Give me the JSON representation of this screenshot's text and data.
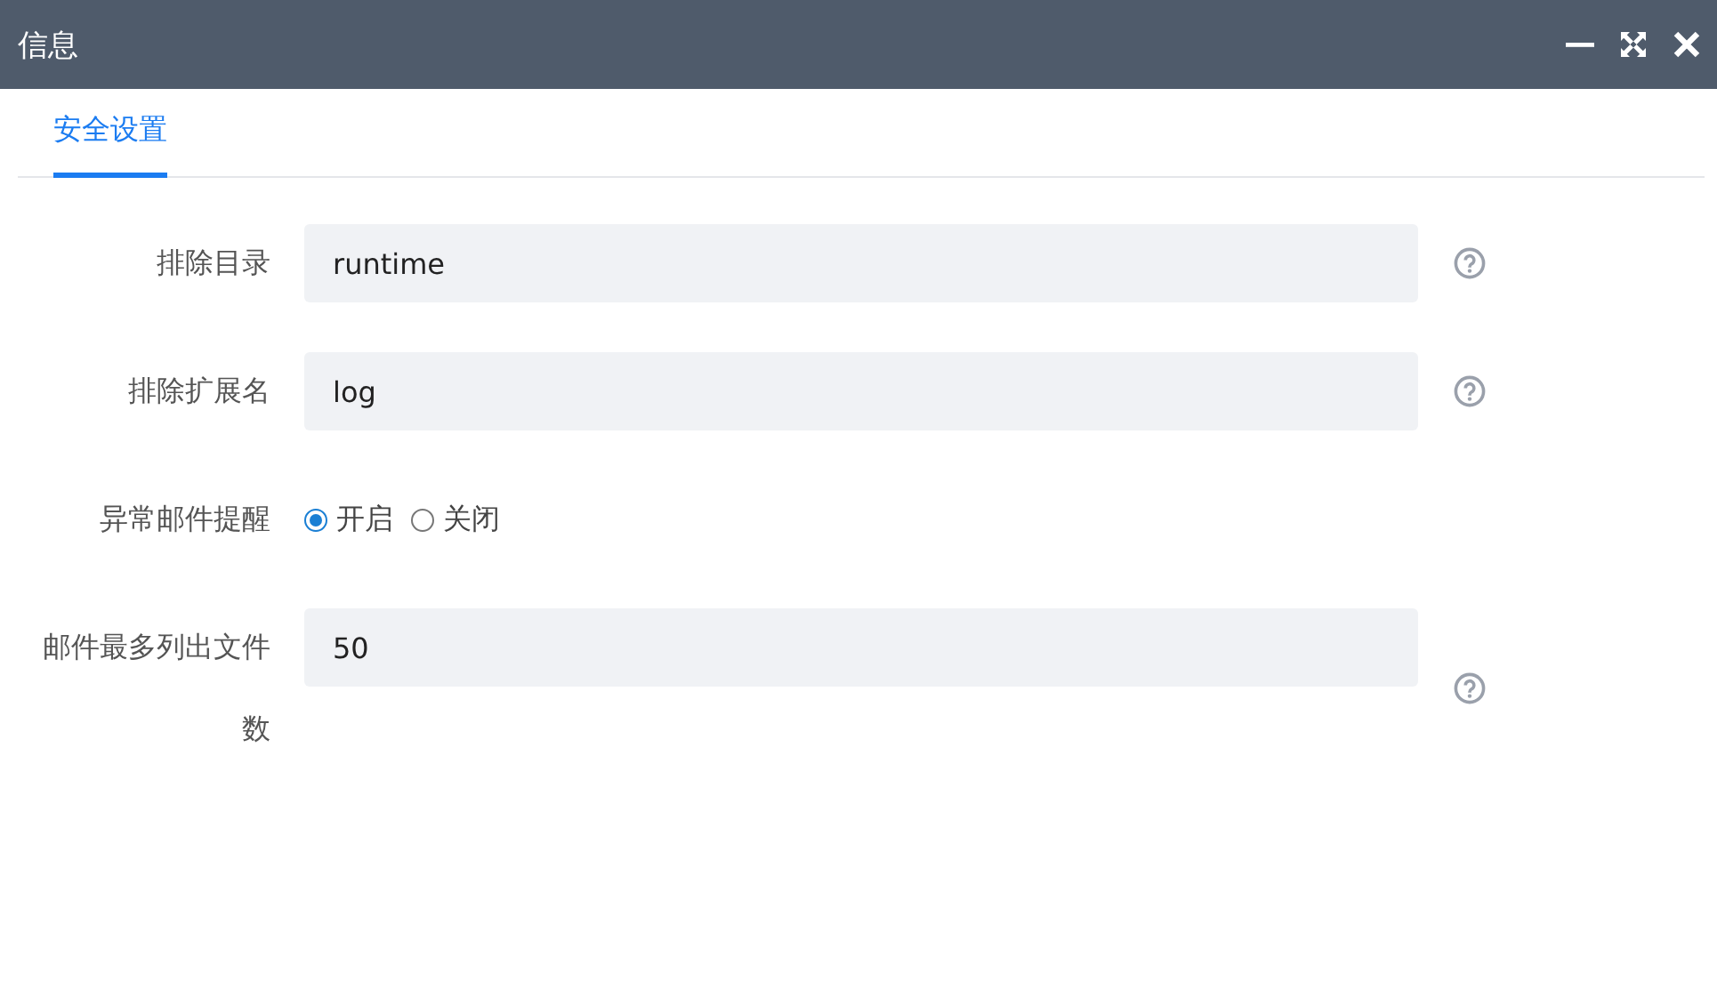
{
  "window": {
    "title": "信息"
  },
  "tabs": [
    {
      "label": "安全设置",
      "selected": true
    }
  ],
  "form": [
    {
      "kind": "text",
      "label": "排除目录",
      "value": "runtime",
      "help": true
    },
    {
      "kind": "text",
      "label": "排除扩展名",
      "value": "log",
      "help": true
    },
    {
      "kind": "radio",
      "label": "异常邮件提醒",
      "options": [
        {
          "label": "开启",
          "selected": true
        },
        {
          "label": "关闭",
          "selected": false
        }
      ]
    },
    {
      "kind": "text",
      "label": "邮件最多列出文件数",
      "value": "50",
      "help": true
    }
  ]
}
